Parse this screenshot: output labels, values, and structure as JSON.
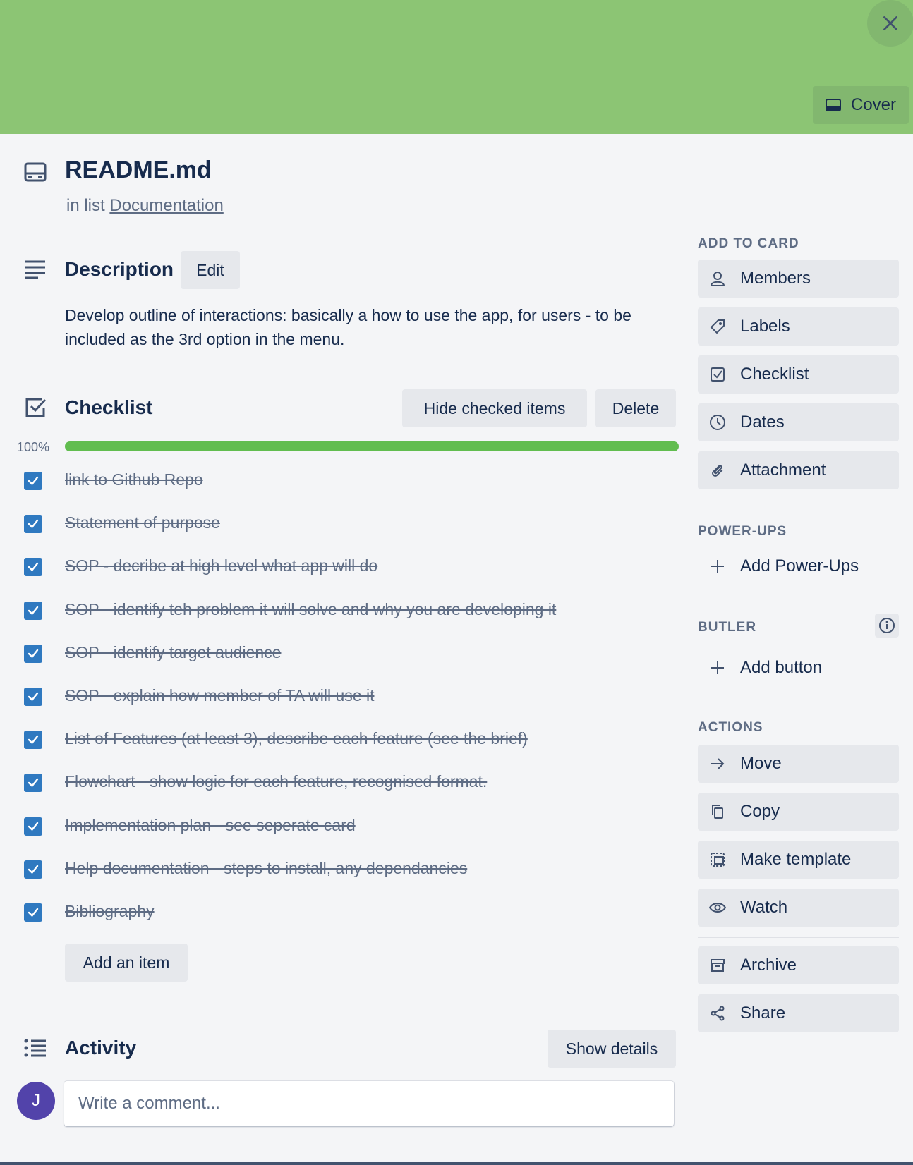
{
  "header": {
    "cover_label": "Cover",
    "cover_color": "#8cc574"
  },
  "card": {
    "title": "README.md",
    "in_list_prefix": "in list",
    "list_name": "Documentation"
  },
  "description": {
    "heading": "Description",
    "edit_label": "Edit",
    "text": "Develop outline of interactions: basically a how to use the app, for users - to be included as the 3rd option in the menu."
  },
  "checklist": {
    "heading": "Checklist",
    "hide_label": "Hide checked items",
    "delete_label": "Delete",
    "percent_text": "100%",
    "progress": 1.0,
    "items": [
      {
        "label": "link to Github Repo",
        "checked": true
      },
      {
        "label": "Statement of purpose",
        "checked": true
      },
      {
        "label": "SOP - decribe at high level what app will do",
        "checked": true
      },
      {
        "label": "SOP - identify teh problem it will solve and why you are developing it",
        "checked": true
      },
      {
        "label": "SOP - identify target audience",
        "checked": true
      },
      {
        "label": "SOP - explain how member of TA will use it",
        "checked": true
      },
      {
        "label": "List of Features (at least 3), describe each feature (see the brief)",
        "checked": true
      },
      {
        "label": "Flowchart - show logic for each feature, recognised format.",
        "checked": true
      },
      {
        "label": "Implementation plan - see seperate card",
        "checked": true
      },
      {
        "label": "Help documentation - steps to install, any dependancies",
        "checked": true
      },
      {
        "label": "Bibliography",
        "checked": true
      }
    ],
    "add_item_label": "Add an item"
  },
  "activity": {
    "heading": "Activity",
    "show_details_label": "Show details",
    "avatar_initial": "J",
    "comment_placeholder": "Write a comment..."
  },
  "sidebar": {
    "add_to_card": {
      "heading": "ADD TO CARD",
      "items": [
        {
          "label": "Members",
          "icon": "person-icon"
        },
        {
          "label": "Labels",
          "icon": "tag-icon"
        },
        {
          "label": "Checklist",
          "icon": "checkbox-icon"
        },
        {
          "label": "Dates",
          "icon": "clock-icon"
        },
        {
          "label": "Attachment",
          "icon": "paperclip-icon"
        }
      ]
    },
    "power_ups": {
      "heading": "POWER-UPS",
      "add_label": "Add Power-Ups"
    },
    "butler": {
      "heading": "BUTLER",
      "add_label": "Add button"
    },
    "actions": {
      "heading": "ACTIONS",
      "items": [
        {
          "label": "Move",
          "icon": "arrow-right-icon"
        },
        {
          "label": "Copy",
          "icon": "copy-icon"
        },
        {
          "label": "Make template",
          "icon": "template-icon"
        },
        {
          "label": "Watch",
          "icon": "eye-icon"
        },
        {
          "label": "Archive",
          "icon": "archive-icon"
        },
        {
          "label": "Share",
          "icon": "share-icon"
        }
      ]
    }
  },
  "colors": {
    "accent_green": "#61bd4f",
    "checkbox_blue": "#2f79c0",
    "avatar_purple": "#5243aa"
  }
}
